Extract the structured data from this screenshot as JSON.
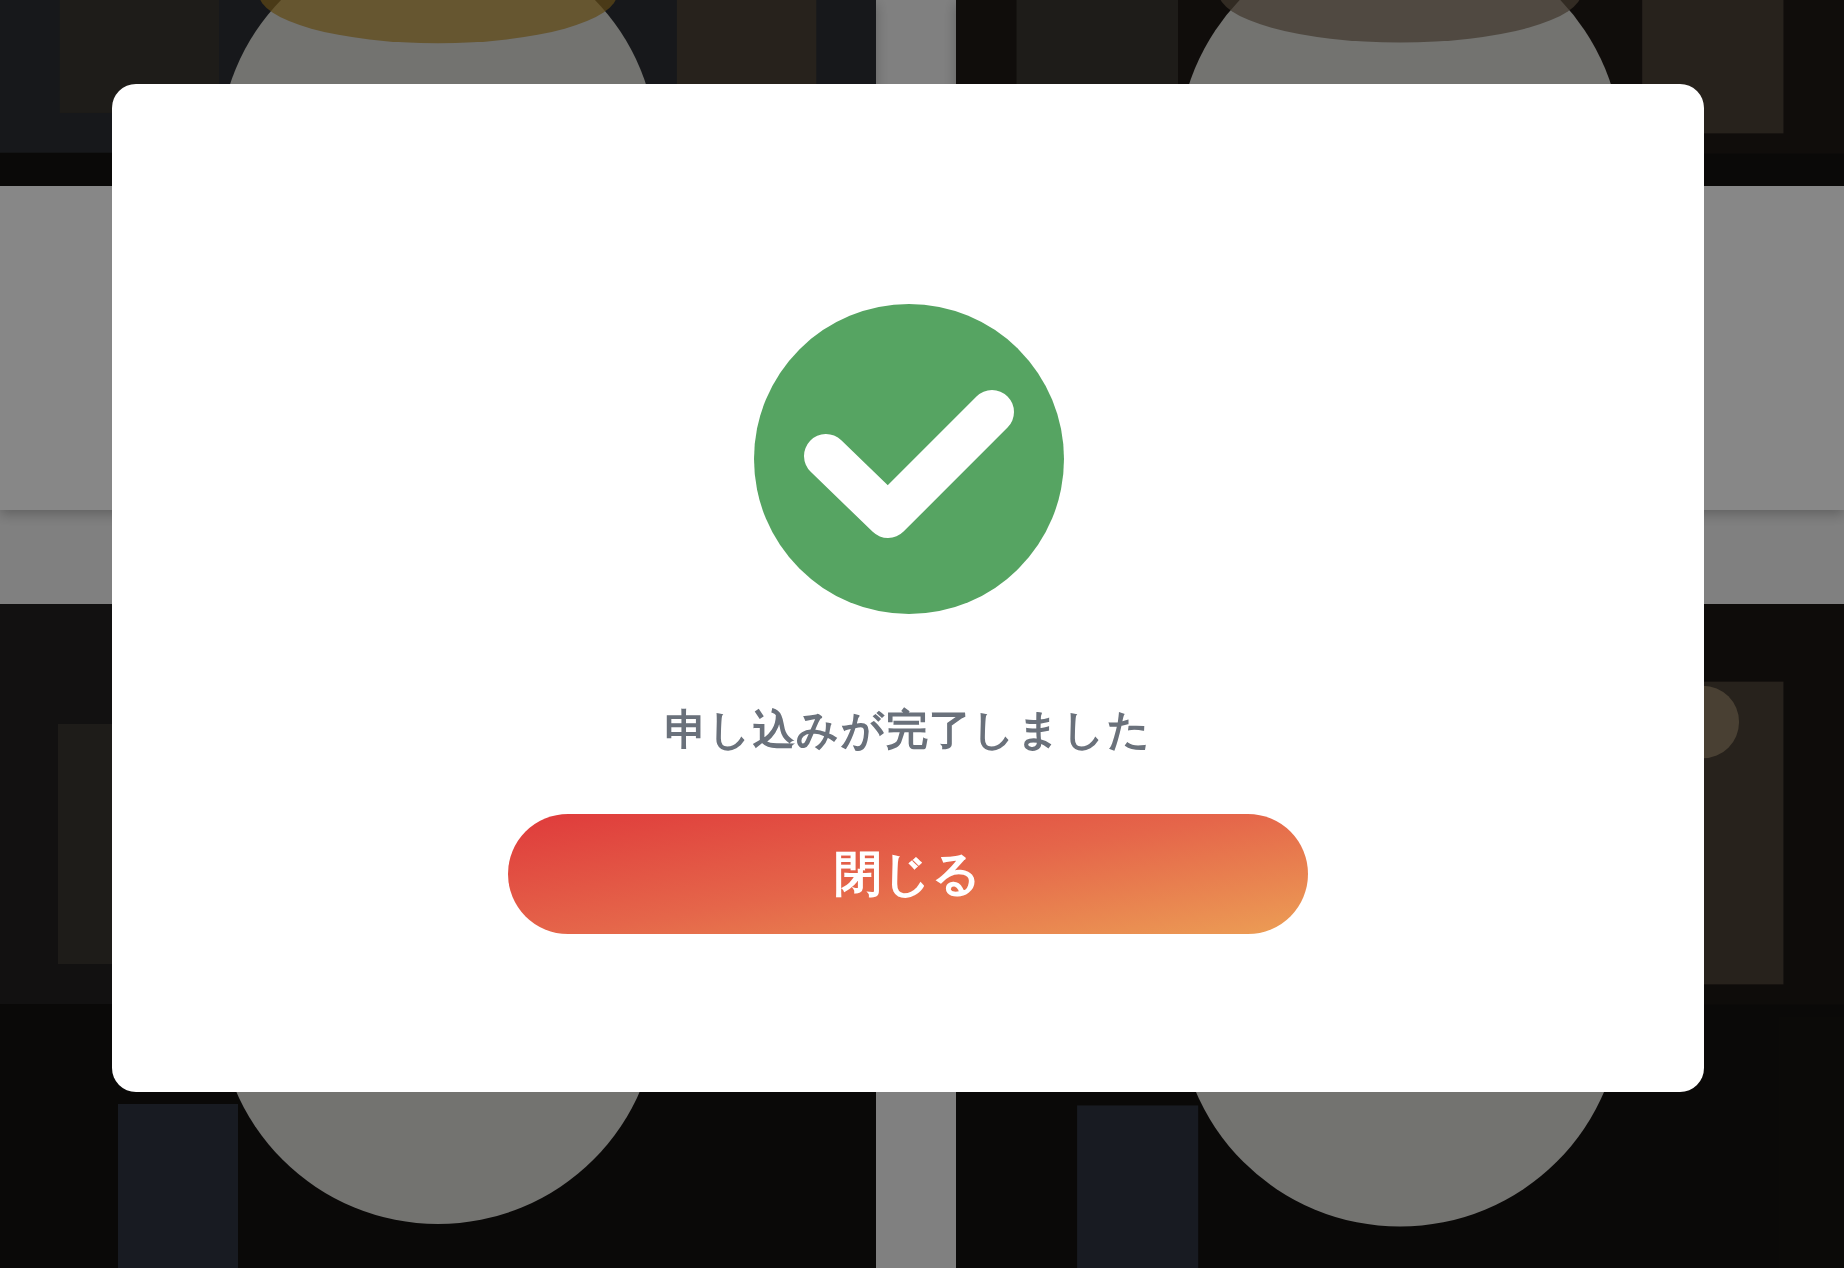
{
  "dialog": {
    "message": "申し込みが完了しました",
    "button": {
      "label": "閉じる"
    }
  }
}
